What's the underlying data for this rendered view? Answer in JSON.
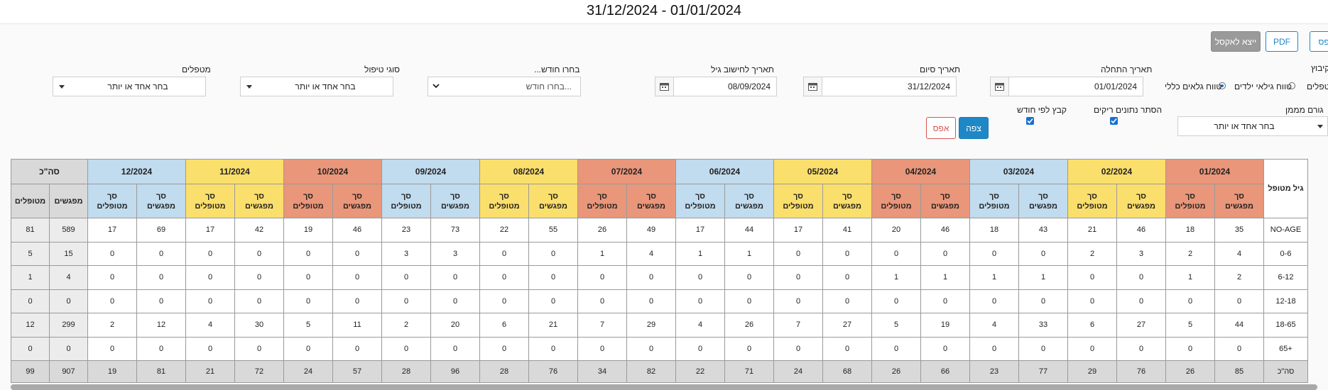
{
  "title": "31/12/2024 - 01/01/2024",
  "toolbar": {
    "print": "הדפס",
    "pdf": "PDF",
    "excel": "ייצא לאקסל"
  },
  "filters": {
    "group_label": "קיבוץ",
    "group_opt1": "מטפלים",
    "group_opt2": "טווח גילאי ילדים",
    "group_opt3": "טווח גלאים כללי",
    "start_label": "תאריך התחלה",
    "start_value": "01/01/2024",
    "end_label": "תאריך סיום",
    "end_value": "31/12/2024",
    "age_calc_label": "תאריך לחישוב גיל",
    "age_calc_value": "08/09/2024",
    "month_label": "בחרו חודש...",
    "month_placeholder": "בחרו חודש...",
    "treat_type_label": "סוגי טיפול",
    "treat_type_value": "בחר אחד או יותר",
    "therapists_label": "מטפלים",
    "therapists_value": "בחר אחד או יותר",
    "funder_label": "גורם מממן",
    "funder_value": "בחר אחד או יותר",
    "hide_empty_label": "הסתר נתונים ריקים",
    "group_month_label": "קבץ לפי חודש",
    "view_btn": "צפה",
    "reset_btn": "אפס"
  },
  "table": {
    "row_header": "גיל מטופל",
    "sub_meetings": "סך מפגשים",
    "sub_patients": "סך מטופלים",
    "total_header": "סה\"כ",
    "total_meetings": "מפגשים",
    "total_patients": "מטופלים",
    "months": [
      {
        "label": "01/2024",
        "color": "#e9967a"
      },
      {
        "label": "02/2024",
        "color": "#fbdf6c"
      },
      {
        "label": "03/2024",
        "color": "#c1dbef"
      },
      {
        "label": "04/2024",
        "color": "#e9967a"
      },
      {
        "label": "05/2024",
        "color": "#fbdf6c"
      },
      {
        "label": "06/2024",
        "color": "#c1dbef"
      },
      {
        "label": "07/2024",
        "color": "#e9967a"
      },
      {
        "label": "08/2024",
        "color": "#fbdf6c"
      },
      {
        "label": "09/2024",
        "color": "#c1dbef"
      },
      {
        "label": "10/2024",
        "color": "#e9967a"
      },
      {
        "label": "11/2024",
        "color": "#fbdf6c"
      },
      {
        "label": "12/2024",
        "color": "#c1dbef"
      }
    ],
    "rows": [
      {
        "label": "NO-AGE",
        "cells": [
          "35",
          "18",
          "46",
          "21",
          "43",
          "18",
          "46",
          "20",
          "41",
          "17",
          "44",
          "17",
          "49",
          "26",
          "55",
          "22",
          "73",
          "23",
          "46",
          "19",
          "42",
          "17",
          "69",
          "17",
          "589",
          "81"
        ]
      },
      {
        "label": "0-6",
        "cells": [
          "4",
          "2",
          "3",
          "2",
          "0",
          "0",
          "0",
          "0",
          "0",
          "0",
          "1",
          "1",
          "4",
          "1",
          "0",
          "0",
          "3",
          "3",
          "0",
          "0",
          "0",
          "0",
          "0",
          "0",
          "15",
          "5"
        ]
      },
      {
        "label": "6-12",
        "cells": [
          "2",
          "1",
          "0",
          "0",
          "1",
          "1",
          "1",
          "1",
          "0",
          "0",
          "0",
          "0",
          "0",
          "0",
          "0",
          "0",
          "0",
          "0",
          "0",
          "0",
          "0",
          "0",
          "0",
          "0",
          "4",
          "1"
        ]
      },
      {
        "label": "12-18",
        "cells": [
          "0",
          "0",
          "0",
          "0",
          "0",
          "0",
          "0",
          "0",
          "0",
          "0",
          "0",
          "0",
          "0",
          "0",
          "0",
          "0",
          "0",
          "0",
          "0",
          "0",
          "0",
          "0",
          "0",
          "0",
          "0",
          "0"
        ]
      },
      {
        "label": "18-65",
        "cells": [
          "44",
          "5",
          "27",
          "6",
          "33",
          "4",
          "19",
          "5",
          "27",
          "7",
          "26",
          "4",
          "29",
          "7",
          "21",
          "6",
          "20",
          "2",
          "11",
          "5",
          "30",
          "4",
          "12",
          "2",
          "299",
          "12"
        ]
      },
      {
        "label": "+65",
        "cells": [
          "0",
          "0",
          "0",
          "0",
          "0",
          "0",
          "0",
          "0",
          "0",
          "0",
          "0",
          "0",
          "0",
          "0",
          "0",
          "0",
          "0",
          "0",
          "0",
          "0",
          "0",
          "0",
          "0",
          "0",
          "0",
          "0"
        ]
      }
    ],
    "total_row": {
      "label": "סה\"כ",
      "cells": [
        "85",
        "26",
        "76",
        "29",
        "77",
        "23",
        "66",
        "26",
        "68",
        "24",
        "71",
        "22",
        "82",
        "34",
        "76",
        "28",
        "96",
        "28",
        "57",
        "24",
        "72",
        "21",
        "81",
        "19",
        "907",
        "99"
      ]
    }
  }
}
